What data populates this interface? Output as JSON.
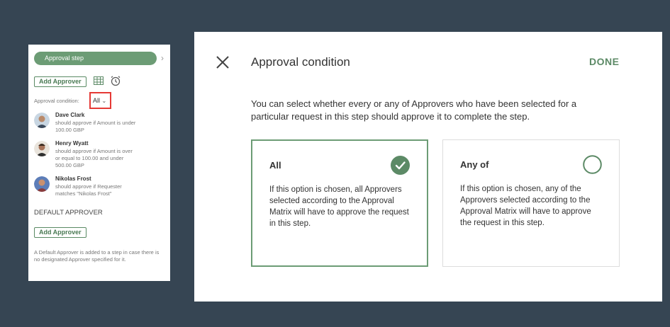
{
  "left_panel": {
    "step_label": "Approval step",
    "add_approver_label": "Add Approver",
    "condition_label": "Approval condition:",
    "condition_value": "All",
    "approvers": [
      {
        "name": "Dave Clark",
        "desc": "should approve if Amount is under 100.00 GBP"
      },
      {
        "name": "Henry Wyatt",
        "desc": "should approve if Amount is over or equal to 100.00 and under 500.00 GBP"
      },
      {
        "name": "Nikolas Frost",
        "desc": "should approve if Requester matches \"Nikolas Frost\""
      }
    ],
    "default_title": "DEFAULT APPROVER",
    "default_add_label": "Add Approver",
    "default_note": "A Default Approver is added to a step in case there is no designated Approver specified for it."
  },
  "dialog": {
    "title": "Approval condition",
    "done_label": "DONE",
    "description": "You can select whether every or any of Approvers who have been selected for a particular request in this step should approve it to complete the step.",
    "options": [
      {
        "title": "All",
        "text": "If this option is chosen, all Approvers selected according to the Approval Matrix will have to approve the request in this step.",
        "selected": true
      },
      {
        "title": "Any of",
        "text": "If this option is chosen, any of the Approvers selected according to the Approval Matrix will have to approve the request in this step.",
        "selected": false
      }
    ]
  },
  "colors": {
    "background": "#364553",
    "accent": "#6c9c75",
    "highlight": "#e53935"
  }
}
